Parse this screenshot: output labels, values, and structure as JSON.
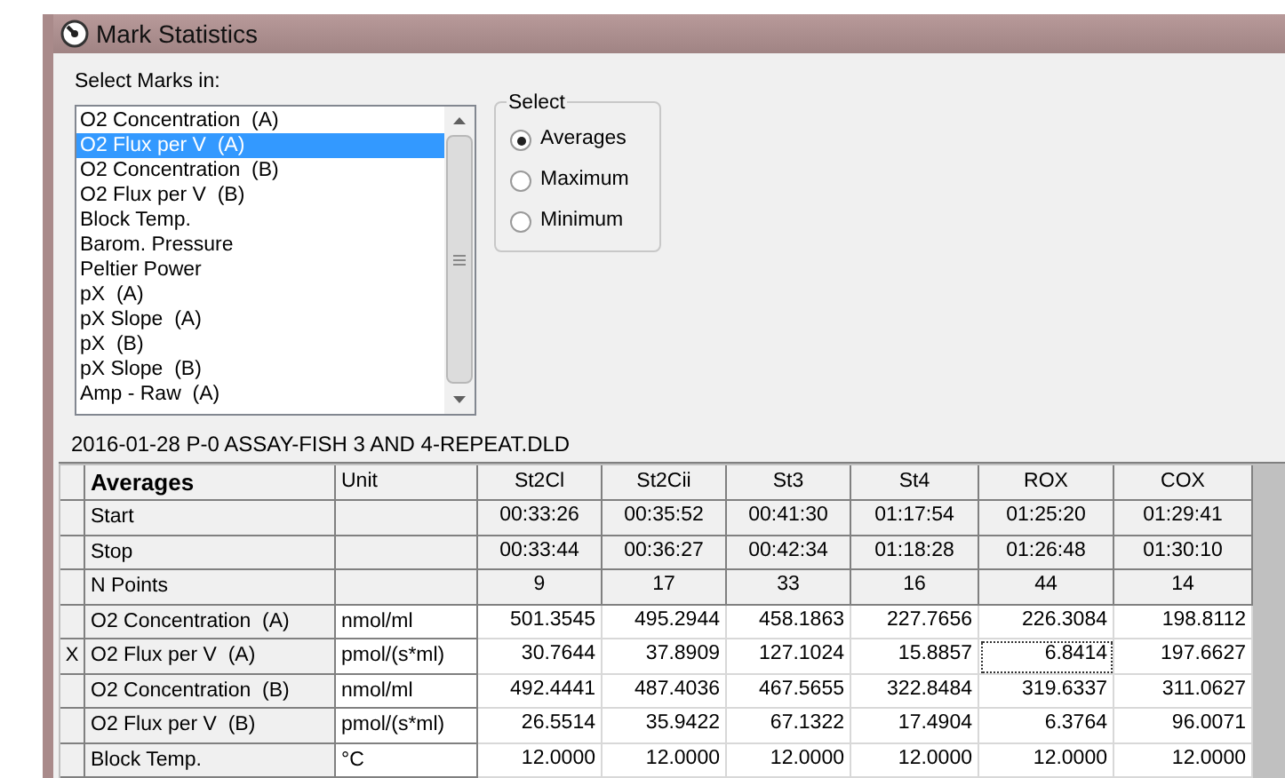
{
  "window": {
    "title": "Mark Statistics"
  },
  "marks_list": {
    "label": "Select Marks in:",
    "items": [
      {
        "label": "O2 Concentration  (A)",
        "selected": false
      },
      {
        "label": "O2 Flux per V  (A)",
        "selected": true
      },
      {
        "label": "O2 Concentration  (B)",
        "selected": false
      },
      {
        "label": "O2 Flux per V  (B)",
        "selected": false
      },
      {
        "label": "Block Temp.",
        "selected": false
      },
      {
        "label": "Barom. Pressure",
        "selected": false
      },
      {
        "label": "Peltier Power",
        "selected": false
      },
      {
        "label": "pX  (A)",
        "selected": false
      },
      {
        "label": "pX Slope  (A)",
        "selected": false
      },
      {
        "label": "pX  (B)",
        "selected": false
      },
      {
        "label": "pX Slope  (B)",
        "selected": false
      },
      {
        "label": "Amp - Raw  (A)",
        "selected": false
      }
    ]
  },
  "select_group": {
    "title": "Select",
    "options": [
      {
        "label": "Averages",
        "selected": true
      },
      {
        "label": "Maximum",
        "selected": false
      },
      {
        "label": "Minimum",
        "selected": false
      }
    ]
  },
  "file_name": "2016-01-28 P-0 ASSAY-FISH 3 AND 4-REPEAT.DLD",
  "table": {
    "columns": [
      "Averages",
      "Unit",
      "St2Cl",
      "St2Cii",
      "St3",
      "St4",
      "ROX",
      "COX"
    ],
    "rows": [
      {
        "kind": "info",
        "marker": "",
        "name": "Start",
        "unit": "",
        "values": [
          {
            "text": "00:33:26",
            "focused": false
          },
          {
            "text": "00:35:52",
            "focused": false
          },
          {
            "text": "00:41:30",
            "focused": false
          },
          {
            "text": "01:17:54",
            "focused": false
          },
          {
            "text": "01:25:20",
            "focused": false
          },
          {
            "text": "01:29:41",
            "focused": false
          }
        ]
      },
      {
        "kind": "info",
        "marker": "",
        "name": "Stop",
        "unit": "",
        "values": [
          {
            "text": "00:33:44",
            "focused": false
          },
          {
            "text": "00:36:27",
            "focused": false
          },
          {
            "text": "00:42:34",
            "focused": false
          },
          {
            "text": "01:18:28",
            "focused": false
          },
          {
            "text": "01:26:48",
            "focused": false
          },
          {
            "text": "01:30:10",
            "focused": false
          }
        ]
      },
      {
        "kind": "info",
        "marker": "",
        "name": "N Points",
        "unit": "",
        "values": [
          {
            "text": "9",
            "focused": false
          },
          {
            "text": "17",
            "focused": false
          },
          {
            "text": "33",
            "focused": false
          },
          {
            "text": "16",
            "focused": false
          },
          {
            "text": "44",
            "focused": false
          },
          {
            "text": "14",
            "focused": false
          }
        ]
      },
      {
        "kind": "data",
        "marker": "",
        "name": "O2 Concentration  (A)",
        "unit": "nmol/ml",
        "values": [
          {
            "text": "501.3545",
            "focused": false
          },
          {
            "text": "495.2944",
            "focused": false
          },
          {
            "text": "458.1863",
            "focused": false
          },
          {
            "text": "227.7656",
            "focused": false
          },
          {
            "text": "226.3084",
            "focused": false
          },
          {
            "text": "198.8112",
            "focused": false
          }
        ]
      },
      {
        "kind": "data",
        "marker": "X",
        "name": "O2 Flux per V  (A)",
        "unit": "pmol/(s*ml)",
        "values": [
          {
            "text": "30.7644",
            "focused": false
          },
          {
            "text": "37.8909",
            "focused": false
          },
          {
            "text": "127.1024",
            "focused": false
          },
          {
            "text": "15.8857",
            "focused": false
          },
          {
            "text": "6.8414",
            "focused": true
          },
          {
            "text": "197.6627",
            "focused": false
          }
        ]
      },
      {
        "kind": "data",
        "marker": "",
        "name": "O2 Concentration  (B)",
        "unit": "nmol/ml",
        "values": [
          {
            "text": "492.4441",
            "focused": false
          },
          {
            "text": "487.4036",
            "focused": false
          },
          {
            "text": "467.5655",
            "focused": false
          },
          {
            "text": "322.8484",
            "focused": false
          },
          {
            "text": "319.6337",
            "focused": false
          },
          {
            "text": "311.0627",
            "focused": false
          }
        ]
      },
      {
        "kind": "data",
        "marker": "",
        "name": "O2 Flux per V  (B)",
        "unit": "pmol/(s*ml)",
        "values": [
          {
            "text": "26.5514",
            "focused": false
          },
          {
            "text": "35.9422",
            "focused": false
          },
          {
            "text": "67.1322",
            "focused": false
          },
          {
            "text": "17.4904",
            "focused": false
          },
          {
            "text": "6.3764",
            "focused": false
          },
          {
            "text": "96.0071",
            "focused": false
          }
        ]
      },
      {
        "kind": "data",
        "marker": "",
        "name": "Block Temp.",
        "unit": "°C",
        "values": [
          {
            "text": "12.0000",
            "focused": false
          },
          {
            "text": "12.0000",
            "focused": false
          },
          {
            "text": "12.0000",
            "focused": false
          },
          {
            "text": "12.0000",
            "focused": false
          },
          {
            "text": "12.0000",
            "focused": false
          },
          {
            "text": "12.0000",
            "focused": false
          }
        ]
      }
    ]
  }
}
